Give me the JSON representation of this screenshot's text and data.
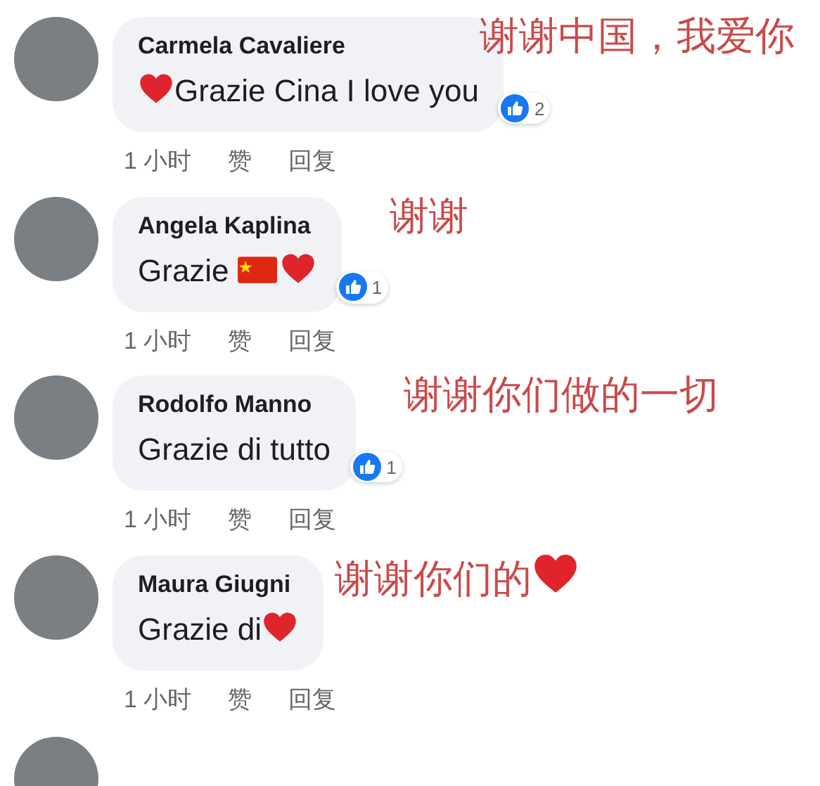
{
  "comments": [
    {
      "author": "Carmela Cavaliere",
      "body": [
        {
          "kind": "heart"
        },
        {
          "kind": "text",
          "text": "Grazie Cina I love you"
        }
      ],
      "time": "1 小时",
      "like": "赞",
      "reply": "回复",
      "reactions": "2",
      "annotation": [
        {
          "kind": "text",
          "text": "谢谢中国，我爱你"
        }
      ]
    },
    {
      "author": "Angela Kaplina",
      "body": [
        {
          "kind": "text",
          "text": "Grazie"
        },
        {
          "kind": "flag"
        },
        {
          "kind": "heart"
        }
      ],
      "time": "1 小时",
      "like": "赞",
      "reply": "回复",
      "reactions": "1",
      "annotation": [
        {
          "kind": "text",
          "text": "谢谢"
        }
      ]
    },
    {
      "author": "Rodolfo Manno",
      "body": [
        {
          "kind": "text",
          "text": "Grazie di tutto"
        }
      ],
      "time": "1 小时",
      "like": "赞",
      "reply": "回复",
      "reactions": "1",
      "annotation": [
        {
          "kind": "text",
          "text": "谢谢你们做的一切"
        }
      ]
    },
    {
      "author": "Maura Giugni",
      "body": [
        {
          "kind": "text",
          "text": "Grazie di"
        },
        {
          "kind": "heart"
        }
      ],
      "time": "1 小时",
      "like": "赞",
      "reply": "回复",
      "annotation": [
        {
          "kind": "text",
          "text": "谢谢你们的"
        },
        {
          "kind": "heart"
        }
      ]
    }
  ]
}
